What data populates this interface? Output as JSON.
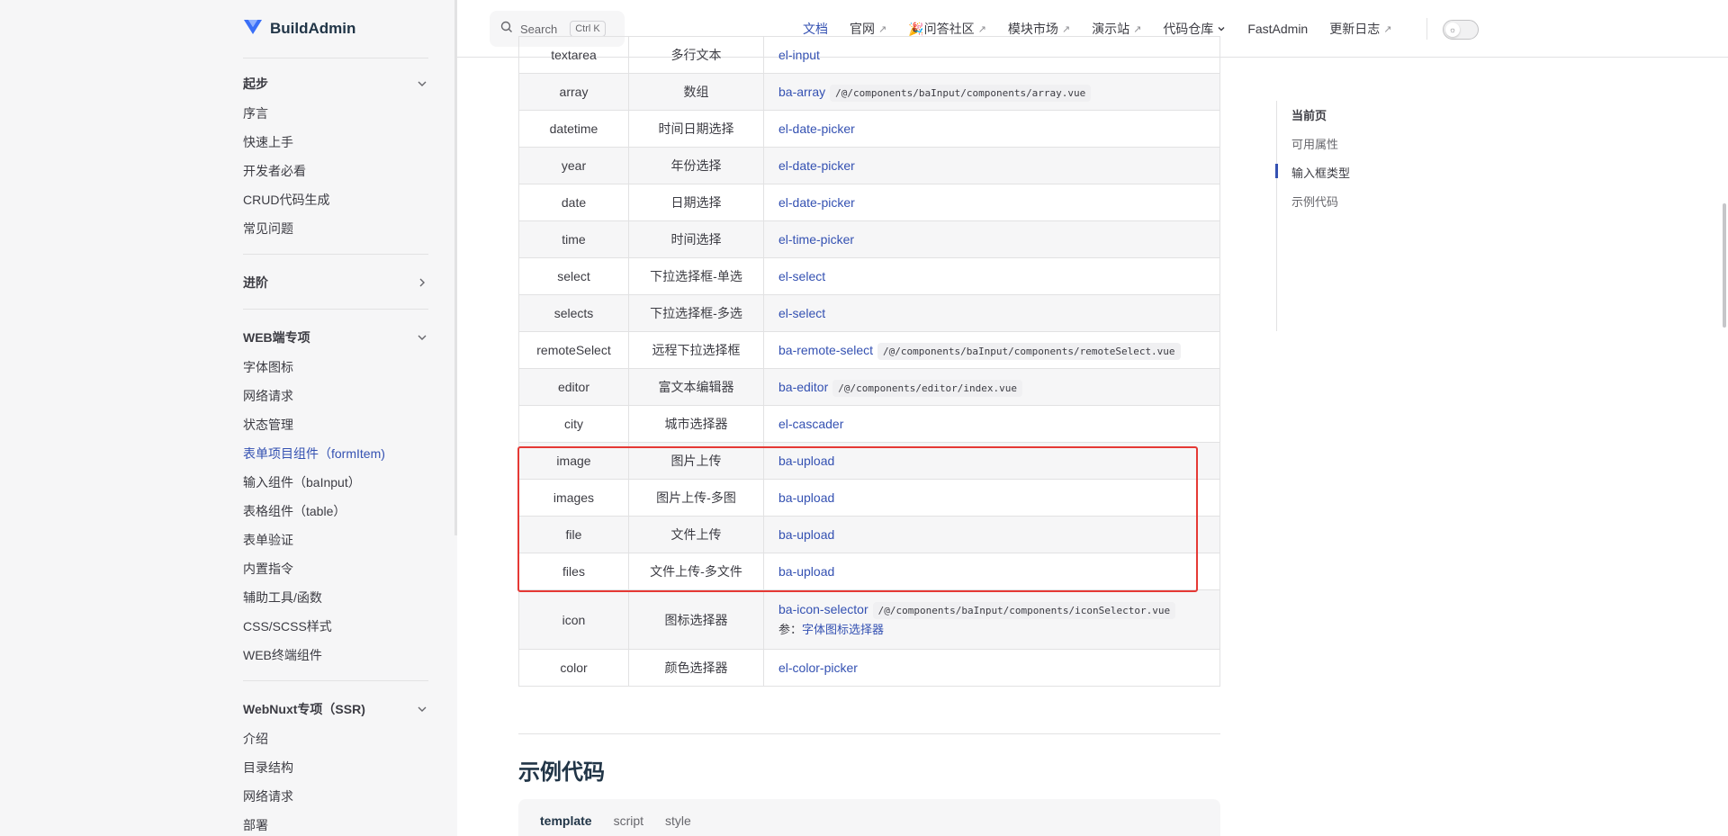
{
  "brand": {
    "name": "BuildAdmin",
    "logo_color": "#3a6ff7"
  },
  "nav": {
    "groups": [
      {
        "title": "起步",
        "expanded": true,
        "items": [
          "序言",
          "快速上手",
          "开发者必看",
          "CRUD代码生成",
          "常见问题"
        ]
      },
      {
        "title": "进阶",
        "expanded": false,
        "items": []
      },
      {
        "title": "WEB端专项",
        "expanded": true,
        "items": [
          "字体图标",
          "网络请求",
          "状态管理",
          "表单项目组件（formItem)",
          "输入组件（baInput）",
          "表格组件（table）",
          "表单验证",
          "内置指令",
          "辅助工具/函数",
          "CSS/SCSS样式",
          "WEB终端组件"
        ]
      },
      {
        "title": "WebNuxt专项（SSR)",
        "expanded": true,
        "items": [
          "介绍",
          "目录结构",
          "网络请求",
          "部署"
        ]
      }
    ],
    "active_item": "表单项目组件（formItem)"
  },
  "topbar": {
    "search_label": "Search",
    "search_kbd": "Ctrl K",
    "menu": [
      {
        "label": "文档",
        "external": false,
        "active": true
      },
      {
        "label": "官网",
        "external": true
      },
      {
        "label": "🎉问答社区",
        "external": true
      },
      {
        "label": "模块市场",
        "external": true
      },
      {
        "label": "演示站",
        "external": true
      },
      {
        "label": "代码仓库",
        "dropdown": true
      },
      {
        "label": "FastAdmin",
        "external": false
      },
      {
        "label": "更新日志",
        "external": true
      }
    ],
    "external_glyph": "↗"
  },
  "table": {
    "rows": [
      {
        "type": "textarea",
        "name": "多行文本",
        "component": "el-input",
        "path": ""
      },
      {
        "type": "array",
        "name": "数组",
        "component": "ba-array",
        "path": "/@/components/baInput/components/array.vue"
      },
      {
        "type": "datetime",
        "name": "时间日期选择",
        "component": "el-date-picker",
        "path": ""
      },
      {
        "type": "year",
        "name": "年份选择",
        "component": "el-date-picker",
        "path": ""
      },
      {
        "type": "date",
        "name": "日期选择",
        "component": "el-date-picker",
        "path": ""
      },
      {
        "type": "time",
        "name": "时间选择",
        "component": "el-time-picker",
        "path": ""
      },
      {
        "type": "select",
        "name": "下拉选择框-单选",
        "component": "el-select",
        "path": ""
      },
      {
        "type": "selects",
        "name": "下拉选择框-多选",
        "component": "el-select",
        "path": ""
      },
      {
        "type": "remoteSelect",
        "name": "远程下拉选择框",
        "component": "ba-remote-select",
        "path": "/@/components/baInput/components/remoteSelect.vue"
      },
      {
        "type": "editor",
        "name": "富文本编辑器",
        "component": "ba-editor",
        "path": "/@/components/editor/index.vue"
      },
      {
        "type": "city",
        "name": "城市选择器",
        "component": "el-cascader",
        "path": ""
      },
      {
        "type": "image",
        "name": "图片上传",
        "component": "ba-upload",
        "path": ""
      },
      {
        "type": "images",
        "name": "图片上传-多图",
        "component": "ba-upload",
        "path": ""
      },
      {
        "type": "file",
        "name": "文件上传",
        "component": "ba-upload",
        "path": ""
      },
      {
        "type": "files",
        "name": "文件上传-多文件",
        "component": "ba-upload",
        "path": ""
      },
      {
        "type": "icon",
        "name": "图标选择器",
        "component": "ba-icon-selector",
        "path": "/@/components/baInput/components/iconSelector.vue",
        "ref_prefix": "参：",
        "ref_link": "字体图标选择器"
      },
      {
        "type": "color",
        "name": "颜色选择器",
        "component": "el-color-picker",
        "path": ""
      }
    ],
    "highlight_color": "#e53935"
  },
  "section": {
    "title": "示例代码",
    "code_tabs": [
      {
        "label": "template",
        "active": true
      },
      {
        "label": "script",
        "active": false
      },
      {
        "label": "style",
        "active": false
      }
    ]
  },
  "outline": {
    "title": "当前页",
    "items": [
      {
        "label": "可用属性",
        "active": false
      },
      {
        "label": "输入框类型",
        "active": true
      },
      {
        "label": "示例代码",
        "active": false
      }
    ]
  },
  "colors": {
    "accent": "#3451b2",
    "text": "#3c3c43",
    "sidebar_bg": "#f6f6f7"
  }
}
